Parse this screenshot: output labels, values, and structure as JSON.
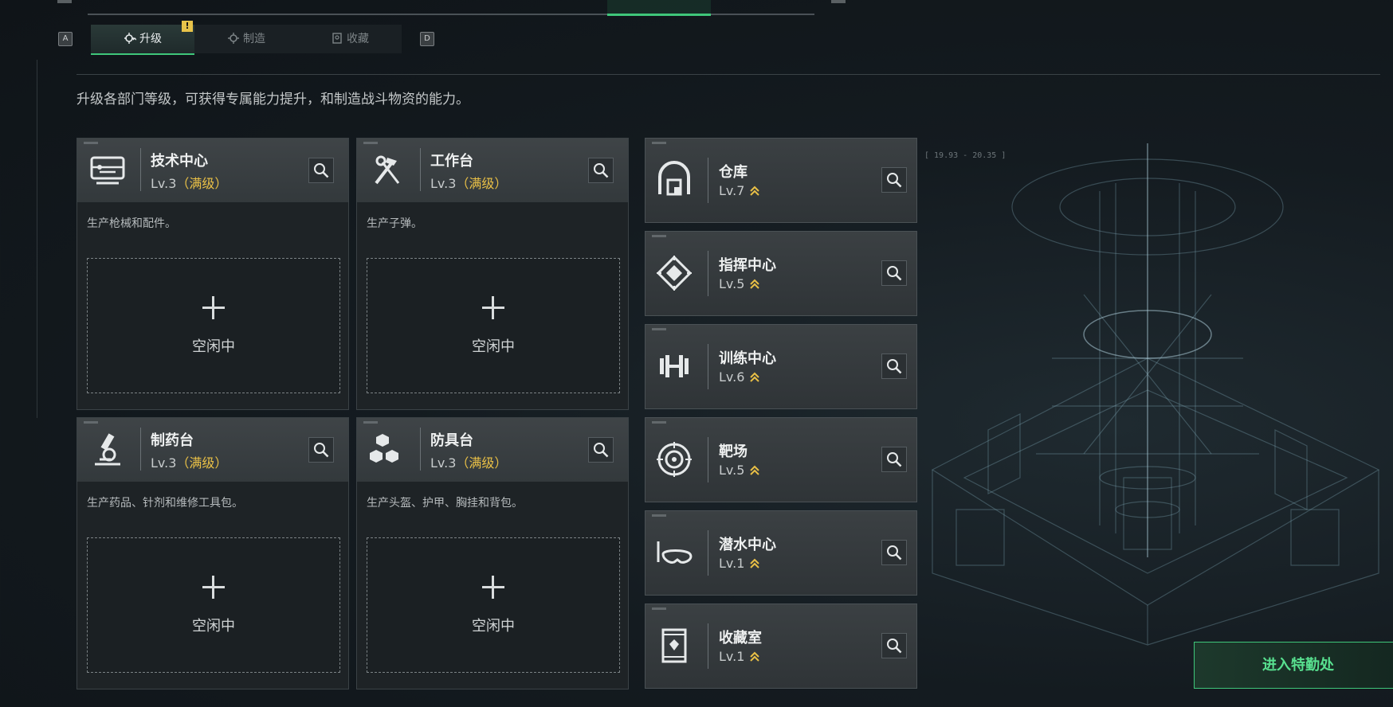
{
  "subtabs": [
    {
      "label": "升级",
      "active": true,
      "badge": "!"
    },
    {
      "label": "制造",
      "active": false
    },
    {
      "label": "收藏",
      "active": false
    }
  ],
  "hotkeys": {
    "left": "A",
    "right": "D"
  },
  "intro": "升级各部门等级，可获得专属能力提升，和制造战斗物资的能力。",
  "main_cards": [
    {
      "name": "技术中心",
      "level": "Lv.3",
      "max": "（满级）",
      "desc": "生产枪械和配件。",
      "icon": "terminal-icon",
      "slot": "空闲中"
    },
    {
      "name": "工作台",
      "level": "Lv.3",
      "max": "（满级）",
      "desc": "生产子弹。",
      "icon": "hammer-wrench-icon",
      "slot": "空闲中"
    },
    {
      "name": "制药台",
      "level": "Lv.3",
      "max": "（满级）",
      "desc": "生产药品、针剂和维修工具包。",
      "icon": "microscope-icon",
      "slot": "空闲中"
    },
    {
      "name": "防具台",
      "level": "Lv.3",
      "max": "（满级）",
      "desc": "生产头盔、护甲、胸挂和背包。",
      "icon": "cubes-icon",
      "slot": "空闲中"
    }
  ],
  "side_cards": [
    {
      "name": "仓库",
      "level": "Lv.7",
      "icon": "warehouse-icon"
    },
    {
      "name": "指挥中心",
      "level": "Lv.5",
      "icon": "command-emblem-icon"
    },
    {
      "name": "训练中心",
      "level": "Lv.6",
      "icon": "dumbbell-icon"
    },
    {
      "name": "靶场",
      "level": "Lv.5",
      "icon": "target-icon"
    },
    {
      "name": "潜水中心",
      "level": "Lv.1",
      "icon": "diving-mask-icon"
    },
    {
      "name": "收藏室",
      "level": "Lv.1",
      "icon": "display-case-icon"
    }
  ],
  "scene_coord": "[ 19.93 - 20.35 ]",
  "enter_button": "进入特勤处",
  "colors": {
    "accent": "#3fc77a",
    "max_level": "#e9c046",
    "upgrade_arrow": "#e9c046"
  }
}
